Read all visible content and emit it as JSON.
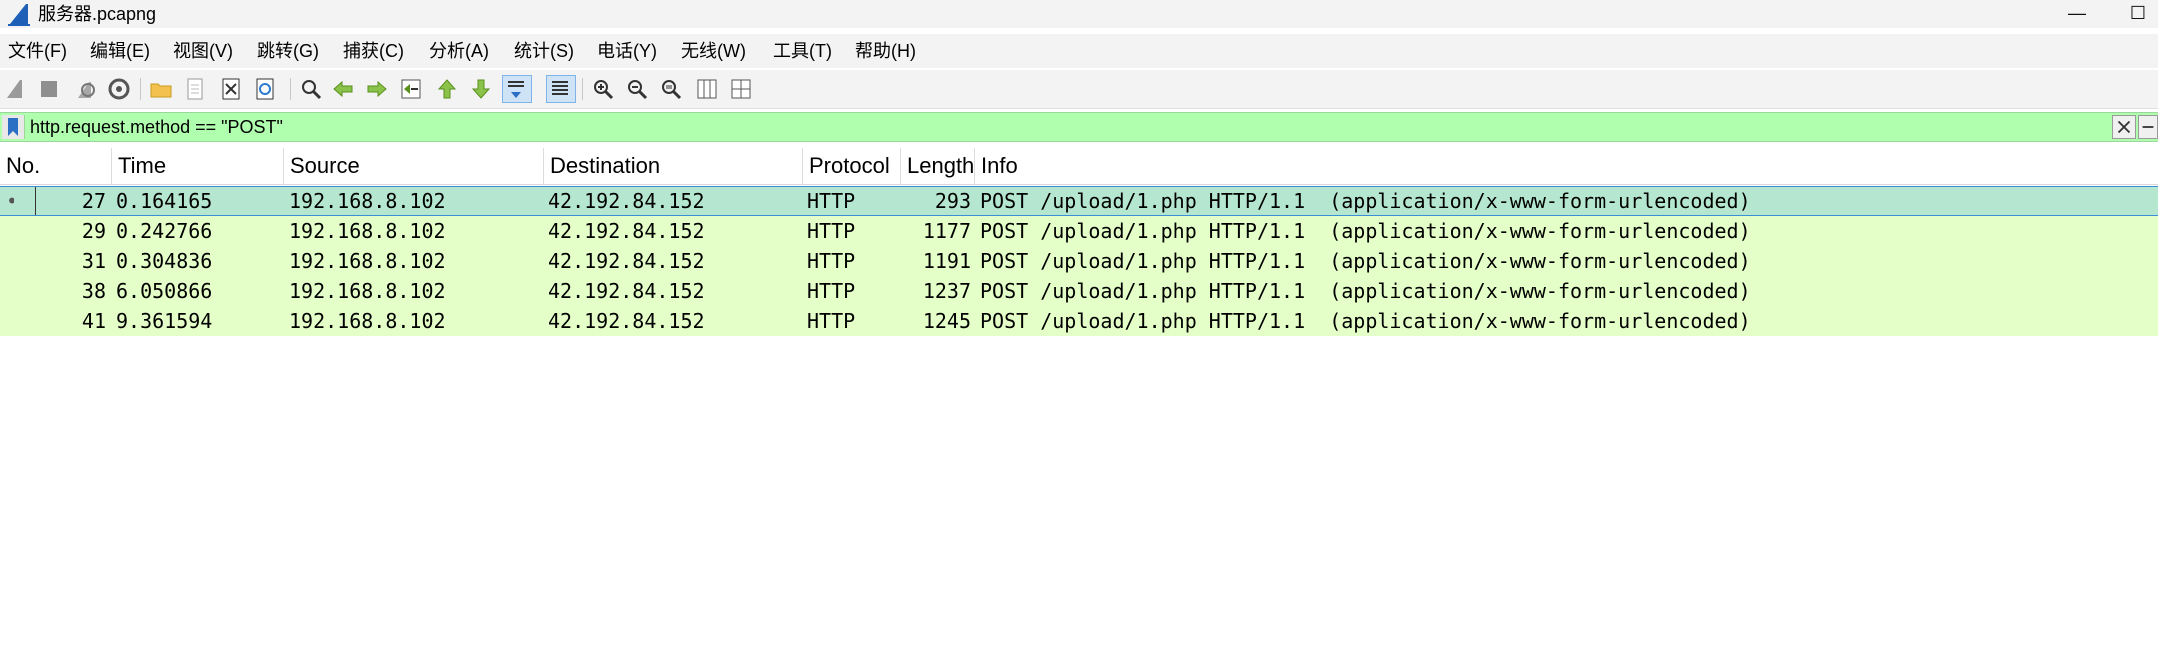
{
  "window": {
    "title": "服务器.pcapng",
    "minimize_glyph": "—",
    "maximize_glyph": "☐"
  },
  "menu": [
    "文件(F)",
    "编辑(E)",
    "视图(V)",
    "跳转(G)",
    "捕获(C)",
    "分析(A)",
    "统计(S)",
    "电话(Y)",
    "无线(W)",
    "工具(T)",
    "帮助(H)"
  ],
  "toolbar": {
    "icons": [
      "start-capture-icon",
      "stop-capture-icon",
      "restart-capture-icon",
      "capture-options-icon",
      "open-file-icon",
      "save-file-icon",
      "close-file-icon",
      "reload-file-icon",
      "find-packet-icon",
      "go-back-icon",
      "go-forward-icon",
      "go-to-packet-icon",
      "go-first-icon",
      "go-last-icon",
      "autoscroll-icon",
      "colorize-icon",
      "zoom-in-icon",
      "zoom-out-icon",
      "normal-size-icon",
      "resize-columns-icon",
      "layout-icon"
    ]
  },
  "filter": {
    "value": "http.request.method == \"POST\"",
    "bg_color": "#afffaf"
  },
  "columns": [
    "No.",
    "Time",
    "Source",
    "Destination",
    "Protocol",
    "Length",
    "Info"
  ],
  "packets": [
    {
      "no": "27",
      "time": "0.164165",
      "source": "192.168.8.102",
      "destination": "42.192.84.152",
      "protocol": "HTTP",
      "length": "293",
      "info": "POST /upload/1.php HTTP/1.1  (application/x-www-form-urlencoded)"
    },
    {
      "no": "29",
      "time": "0.242766",
      "source": "192.168.8.102",
      "destination": "42.192.84.152",
      "protocol": "HTTP",
      "length": "1177",
      "info": "POST /upload/1.php HTTP/1.1  (application/x-www-form-urlencoded)"
    },
    {
      "no": "31",
      "time": "0.304836",
      "source": "192.168.8.102",
      "destination": "42.192.84.152",
      "protocol": "HTTP",
      "length": "1191",
      "info": "POST /upload/1.php HTTP/1.1  (application/x-www-form-urlencoded)"
    },
    {
      "no": "38",
      "time": "6.050866",
      "source": "192.168.8.102",
      "destination": "42.192.84.152",
      "protocol": "HTTP",
      "length": "1237",
      "info": "POST /upload/1.php HTTP/1.1  (application/x-www-form-urlencoded)"
    },
    {
      "no": "41",
      "time": "9.361594",
      "source": "192.168.8.102",
      "destination": "42.192.84.152",
      "protocol": "HTTP",
      "length": "1245",
      "info": "POST /upload/1.php HTTP/1.1  (application/x-www-form-urlencoded)"
    }
  ],
  "colors": {
    "http_row": "#e4ffc7",
    "selected_row": "#b5e7d0",
    "selection_border": "#3a8fd8"
  }
}
